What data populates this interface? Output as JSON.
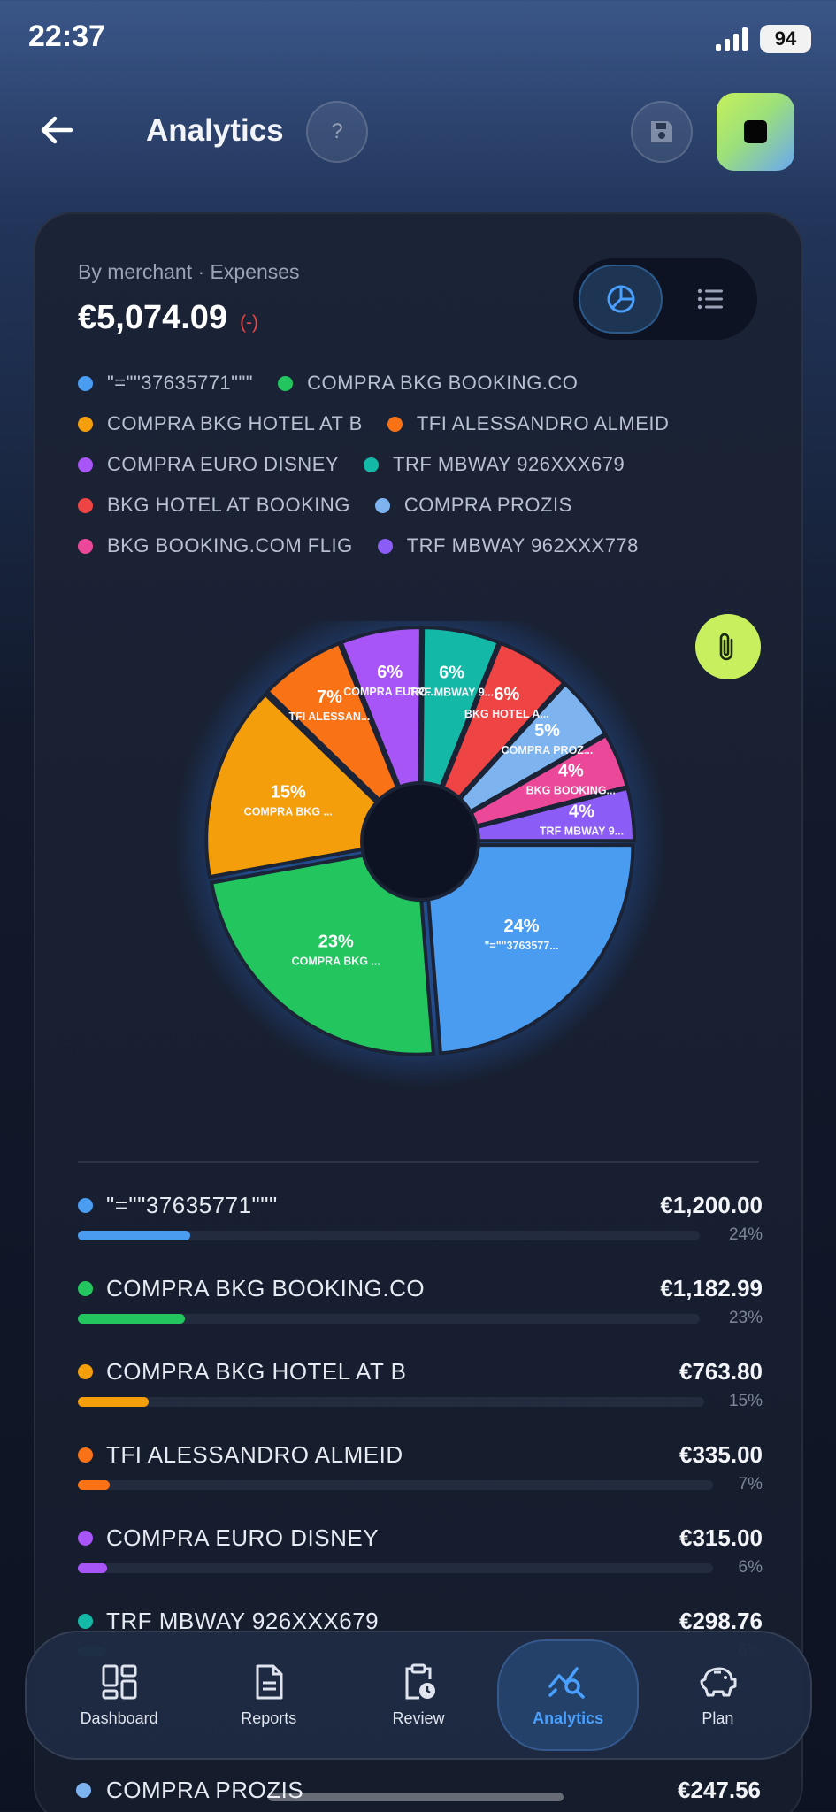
{
  "status": {
    "time": "22:37",
    "battery": "94"
  },
  "header": {
    "title": "Analytics",
    "help_label": "?"
  },
  "summary": {
    "subtitle": "By merchant · Expenses",
    "total": "€5,074.09",
    "delta": "(-)"
  },
  "colors": {
    "blue": "#4a9cf0",
    "green": "#22c55e",
    "amber": "#f59e0b",
    "orange": "#f97316",
    "purple": "#a855f7",
    "teal": "#14b8a6",
    "red": "#ef4444",
    "lightblue": "#7db4f0",
    "pink": "#ec4899",
    "violet": "#8b5cf6"
  },
  "legend": [
    {
      "label": "\"=\"\"37635771\"\"\"",
      "color": "#4a9cf0"
    },
    {
      "label": "COMPRA BKG BOOKING.CO",
      "color": "#22c55e"
    },
    {
      "label": "COMPRA BKG HOTEL AT B",
      "color": "#f59e0b"
    },
    {
      "label": "TFI ALESSANDRO ALMEID",
      "color": "#f97316"
    },
    {
      "label": "COMPRA EURO DISNEY",
      "color": "#a855f7"
    },
    {
      "label": "TRF MBWAY 926XXX679",
      "color": "#14b8a6"
    },
    {
      "label": "BKG HOTEL AT BOOKING",
      "color": "#ef4444"
    },
    {
      "label": "COMPRA PROZIS",
      "color": "#7db4f0"
    },
    {
      "label": "BKG BOOKING.COM FLIG",
      "color": "#ec4899"
    },
    {
      "label": "TRF MBWAY 962XXX778",
      "color": "#8b5cf6"
    }
  ],
  "chart_data": {
    "type": "pie",
    "title": "",
    "slices": [
      {
        "label": "\"=\"\"37635771\"\"\"",
        "short": "\"=\"\"3763577...",
        "pct_label": "24%",
        "value": 1200.0,
        "color": "#4a9cf0"
      },
      {
        "label": "COMPRA BKG BOOKING.CO",
        "short": "COMPRA BKG ...",
        "pct_label": "23%",
        "value": 1182.99,
        "color": "#22c55e"
      },
      {
        "label": "COMPRA BKG HOTEL AT B",
        "short": "COMPRA BKG ...",
        "pct_label": "15%",
        "value": 763.8,
        "color": "#f59e0b"
      },
      {
        "label": "TFI ALESSANDRO ALMEID",
        "short": "TFI ALESSAN...",
        "pct_label": "7%",
        "value": 335.0,
        "color": "#f97316"
      },
      {
        "label": "COMPRA EURO DISNEY",
        "short": "COMPRA EURO...",
        "pct_label": "6%",
        "value": 315.0,
        "color": "#a855f7"
      },
      {
        "label": "TRF MBWAY 926XXX679",
        "short": "TRF MBWAY 9...",
        "pct_label": "6%",
        "value": 298.76,
        "color": "#14b8a6"
      },
      {
        "label": "BKG HOTEL AT BOOKING",
        "short": "BKG HOTEL A...",
        "pct_label": "6%",
        "value": 290.0,
        "color": "#ef4444"
      },
      {
        "label": "COMPRA PROZIS",
        "short": "COMPRA PROZ...",
        "pct_label": "5%",
        "value": 247.56,
        "color": "#7db4f0"
      },
      {
        "label": "BKG BOOKING.COM FLIG",
        "short": "BKG BOOKING...",
        "pct_label": "4%",
        "value": 215.0,
        "color": "#ec4899"
      },
      {
        "label": "TRF MBWAY 962XXX778",
        "short": "TRF MBWAY 9...",
        "pct_label": "4%",
        "value": 205.0,
        "color": "#8b5cf6"
      }
    ]
  },
  "list": [
    {
      "name": "\"=\"\"37635771\"\"\"",
      "amount": "€1,200.00",
      "pct": "24%",
      "fraction": 0.24,
      "color": "#4a9cf0"
    },
    {
      "name": "COMPRA BKG BOOKING.CO",
      "amount": "€1,182.99",
      "pct": "23%",
      "fraction": 0.23,
      "color": "#22c55e"
    },
    {
      "name": "COMPRA BKG HOTEL AT B",
      "amount": "€763.80",
      "pct": "15%",
      "fraction": 0.15,
      "color": "#f59e0b"
    },
    {
      "name": "TFI ALESSANDRO ALMEID",
      "amount": "€335.00",
      "pct": "7%",
      "fraction": 0.066,
      "color": "#f97316"
    },
    {
      "name": "COMPRA EURO DISNEY",
      "amount": "€315.00",
      "pct": "6%",
      "fraction": 0.062,
      "color": "#a855f7"
    },
    {
      "name": "TRF MBWAY 926XXX679",
      "amount": "€298.76",
      "pct": "6%",
      "fraction": 0.059,
      "color": "#14b8a6"
    }
  ],
  "below_nav_item": {
    "name": "COMPRA PROZIS",
    "amount": "€247.56",
    "color": "#7db4f0"
  },
  "nav": [
    {
      "label": "Dashboard",
      "icon": "dashboard-icon"
    },
    {
      "label": "Reports",
      "icon": "document-icon"
    },
    {
      "label": "Review",
      "icon": "clipboard-clock-icon"
    },
    {
      "label": "Analytics",
      "icon": "analytics-icon"
    },
    {
      "label": "Plan",
      "icon": "piggy-bank-icon"
    }
  ]
}
